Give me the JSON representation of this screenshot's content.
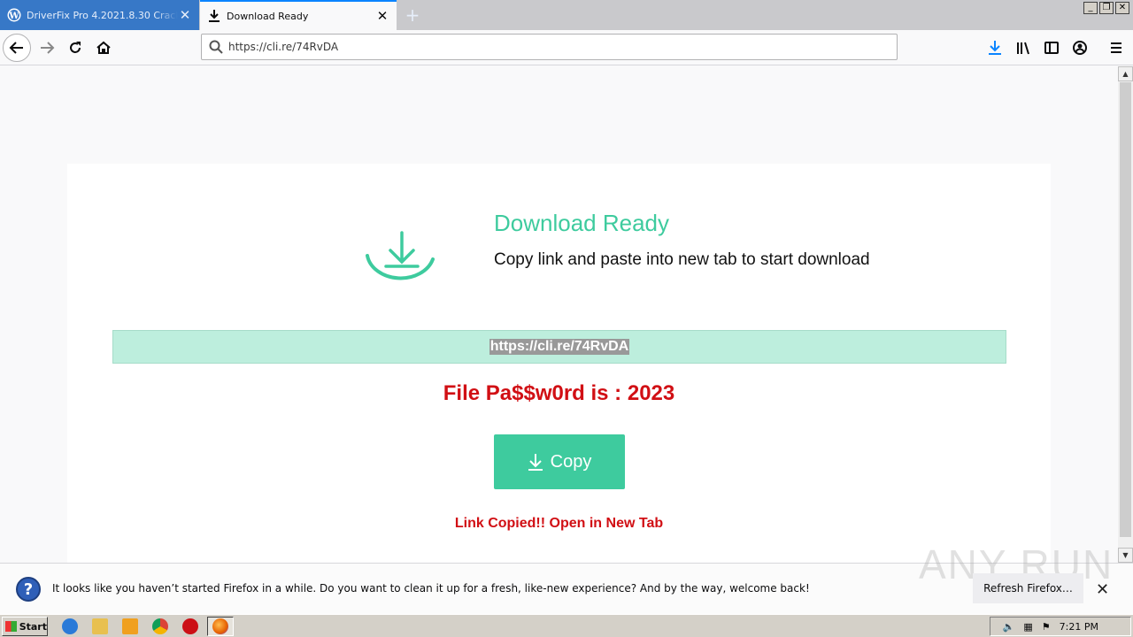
{
  "browser": {
    "tabs": [
      {
        "title": "DriverFix Pro 4.2021.8.30 Crack +",
        "active": false
      },
      {
        "title": "Download Ready",
        "active": true
      }
    ],
    "url": "https://cli.re/74RvDA"
  },
  "page": {
    "title": "Download Ready",
    "subtitle": "Copy link and paste into new tab to start download",
    "link": "https://cli.re/74RvDA",
    "password_text": "File Pa$$w0rd is : 2023",
    "copy_label": "Copy",
    "copied_text": "Link Copied!! Open in New Tab",
    "accent_color": "#3ecb9e",
    "alert_color": "#d10f14"
  },
  "notification": {
    "text": "It looks like you haven’t started Firefox in a while. Do you want to clean it up for a fresh, like-new experience? And by the way, welcome back!",
    "button_label": "Refresh Firefox…"
  },
  "watermark": "ANY RUN",
  "taskbar": {
    "start_label": "Start",
    "clock": "7:21 PM"
  }
}
